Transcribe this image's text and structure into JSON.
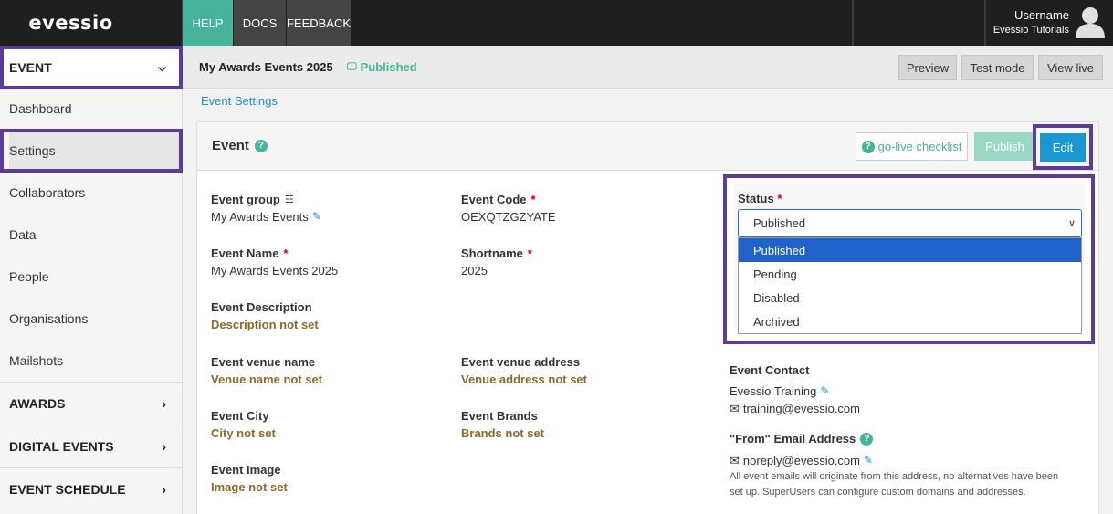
{
  "app": {
    "logo": "evessio"
  },
  "topnav": {
    "help": "HELP",
    "docs": "DOCS",
    "feedback": "FEEDBACK"
  },
  "user": {
    "name": "Username",
    "org": "Evessio Tutorials"
  },
  "sidebar": {
    "header": "EVENT",
    "items": [
      {
        "label": "Dashboard"
      },
      {
        "label": "Settings"
      },
      {
        "label": "Collaborators"
      },
      {
        "label": "Data"
      },
      {
        "label": "People"
      },
      {
        "label": "Organisations"
      },
      {
        "label": "Mailshots"
      }
    ],
    "sections": [
      {
        "label": "AWARDS"
      },
      {
        "label": "DIGITAL EVENTS"
      },
      {
        "label": "EVENT SCHEDULE"
      }
    ]
  },
  "header": {
    "event_title": "My Awards Events 2025",
    "status": "Published",
    "preview": "Preview",
    "test_mode": "Test mode",
    "view_live": "View live"
  },
  "breadcrumb": "Event Settings",
  "panel": {
    "title": "Event",
    "golive": "go-live checklist",
    "publish": "Publish",
    "edit": "Edit"
  },
  "fields": {
    "event_group_label": "Event group",
    "event_group_value": "My Awards Events",
    "event_code_label": "Event Code",
    "event_code_value": "OEXQTZGZYATE",
    "event_name_label": "Event Name",
    "event_name_value": "My Awards Events 2025",
    "shortname_label": "Shortname",
    "shortname_value": "2025",
    "description_label": "Event Description",
    "description_value": "Description not set",
    "venue_name_label": "Event venue name",
    "venue_name_value": "Venue name not set",
    "venue_address_label": "Event venue address",
    "venue_address_value": "Venue address not set",
    "city_label": "Event City",
    "city_value": "City not set",
    "brands_label": "Event Brands",
    "brands_value": "Brands not set",
    "image_label": "Event Image",
    "image_value": "Image not set",
    "required_mark": "*"
  },
  "status_field": {
    "label": "Status",
    "selected": "Published",
    "options": [
      "Published",
      "Pending",
      "Disabled",
      "Archived"
    ]
  },
  "contact": {
    "label": "Event Contact",
    "name": "Evessio Training",
    "email": "training@evessio.com",
    "from_label": "\"From\" Email Address",
    "from_email": "noreply@evessio.com",
    "note_line1": "All event emails will originate from this address, no alternatives have been",
    "note_line2": "set up. SuperUsers can configure custom domains and addresses."
  },
  "colors": {
    "accent": "#46b39a",
    "highlight": "#5b3c98",
    "primary": "#1a96d2",
    "notset": "#8b6a2a"
  }
}
